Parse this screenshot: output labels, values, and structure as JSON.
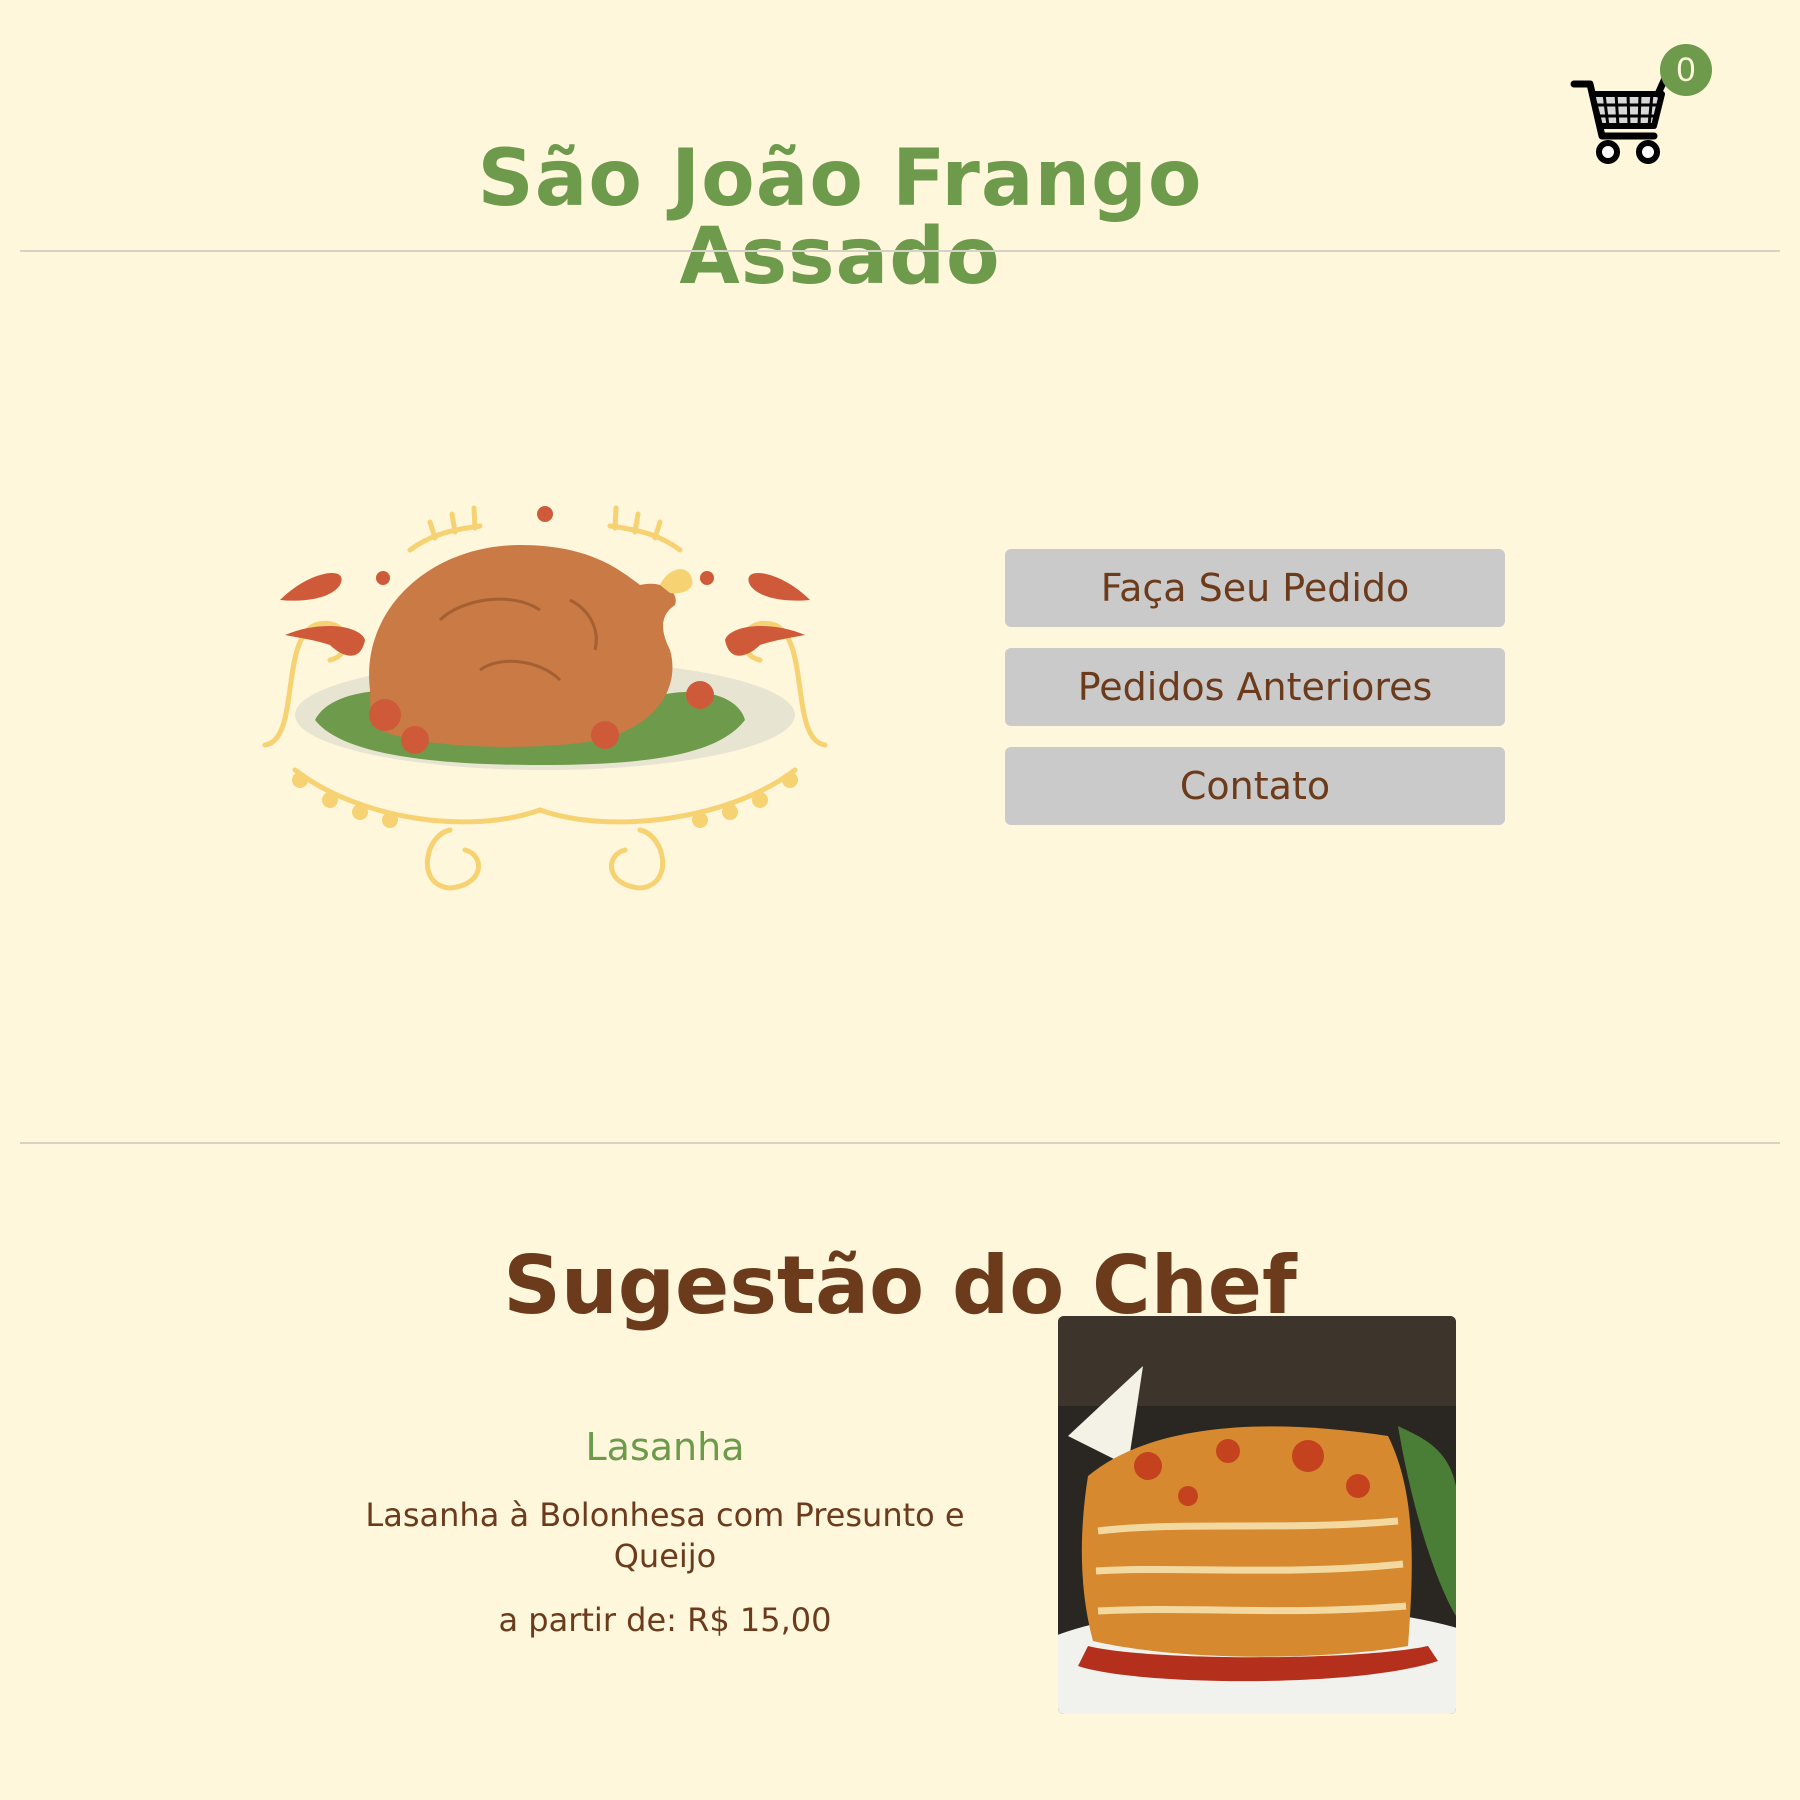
{
  "header": {
    "title": "São João Frango Assado",
    "cart_count": "0"
  },
  "hero": {
    "image_icon": "roast-chicken-illustration"
  },
  "nav": {
    "items": [
      {
        "label": "Faça Seu Pedido"
      },
      {
        "label": "Pedidos Anteriores"
      },
      {
        "label": "Contato"
      }
    ]
  },
  "suggestion": {
    "title": "Sugestão do Chef",
    "dish": {
      "name": "Lasanha",
      "description": "Lasanha à Bolonhesa com Presunto e Queijo",
      "price": "a partir de: R$ 15,00",
      "image_icon": "lasagna-photo"
    }
  },
  "colors": {
    "background": "#fef7dc",
    "accent_green": "#6e9a4b",
    "text_brown": "#6b3b1c",
    "button_gray": "#cacaca"
  }
}
